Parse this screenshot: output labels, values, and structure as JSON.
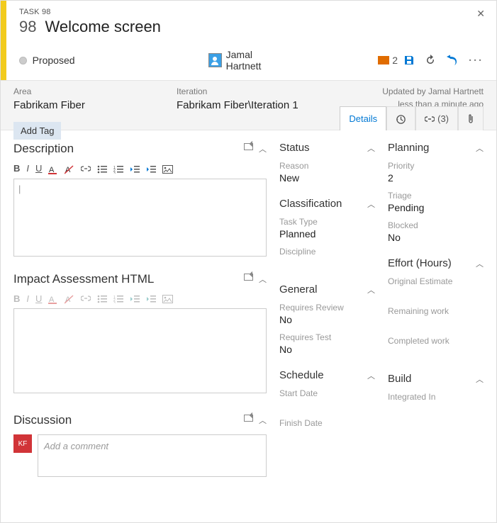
{
  "header": {
    "type_label": "TASK 98",
    "number": "98",
    "title": "Welcome screen",
    "state": "Proposed",
    "assignee": "Jamal Hartnett",
    "comment_count": "2"
  },
  "info": {
    "area_label": "Area",
    "area_value": "Fabrikam Fiber",
    "iteration_label": "Iteration",
    "iteration_value": "Fabrikam Fiber\\Iteration 1",
    "updated_by": "Updated by Jamal Hartnett",
    "updated_time": "less than a minute ago",
    "add_tag": "Add Tag"
  },
  "tabs": {
    "details": "Details",
    "links_count": "(3)"
  },
  "main": {
    "description_title": "Description",
    "impact_title": "Impact Assessment HTML",
    "discussion_title": "Discussion",
    "comment_placeholder": "Add a comment",
    "disc_avatar": "KF"
  },
  "status": {
    "title": "Status",
    "reason_label": "Reason",
    "reason_value": "New",
    "classification_title": "Classification",
    "tasktype_label": "Task Type",
    "tasktype_value": "Planned",
    "discipline_label": "Discipline",
    "general_title": "General",
    "req_review_label": "Requires Review",
    "req_review_value": "No",
    "req_test_label": "Requires Test",
    "req_test_value": "No",
    "schedule_title": "Schedule",
    "start_label": "Start Date",
    "finish_label": "Finish Date"
  },
  "planning": {
    "title": "Planning",
    "priority_label": "Priority",
    "priority_value": "2",
    "triage_label": "Triage",
    "triage_value": "Pending",
    "blocked_label": "Blocked",
    "blocked_value": "No",
    "effort_title": "Effort (Hours)",
    "orig_label": "Original Estimate",
    "remain_label": "Remaining work",
    "completed_label": "Completed work",
    "build_title": "Build",
    "integrated_label": "Integrated In"
  }
}
